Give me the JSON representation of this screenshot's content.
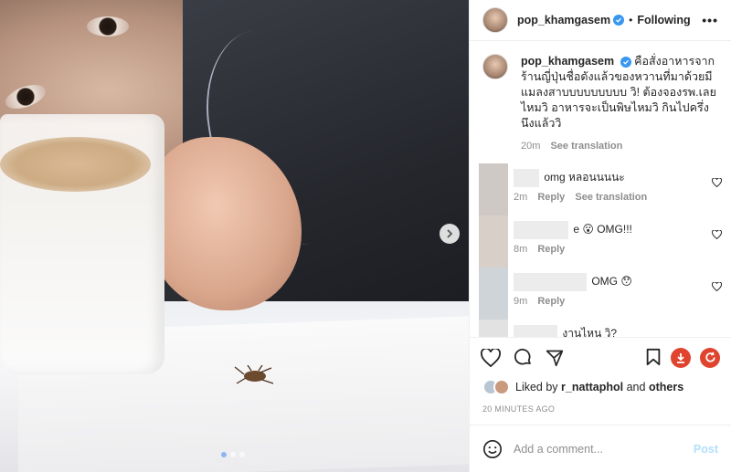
{
  "post": {
    "username": "pop_khamgasem",
    "follow_label": "Following",
    "dot_separator": "•",
    "more_label": "•••"
  },
  "caption": {
    "username": "pop_khamgasem",
    "text": "คือสั่งอาหารจากร้านญี่ปุ่นชื่อดังแล้วของหวานที่มาด้วยมีแมลงสาบบบบบบบบบ วิ! ต้องจองรพ.เลยไหมวิ อาหารจะเป็นพิษไหมวิ กินไปครึ่งนึงแล้ววิ",
    "age": "20m",
    "see_translation": "See translation"
  },
  "comments": [
    {
      "text": "omg หลอนนนนะ",
      "age": "2m",
      "reply": "Reply",
      "see_translation": "See translation"
    },
    {
      "text": "e 😮 OMG!!!",
      "age": "8m",
      "reply": "Reply"
    },
    {
      "text": "OMG 😯",
      "age": "9m",
      "reply": "Reply"
    },
    {
      "text": "งานไหน วิ?",
      "age": "",
      "reply": ""
    }
  ],
  "likes": {
    "prefix": "Liked by",
    "user": "r_nattaphol",
    "and": "and",
    "others": "others"
  },
  "timestamp": "20 MINUTES AGO",
  "add_comment": {
    "placeholder": "Add a comment...",
    "post_label": "Post"
  },
  "colors": {
    "verified": "#3897f0",
    "save_red": "#e0442e",
    "post_disabled": "#b2dffc"
  },
  "icons": [
    "heart-icon",
    "comment-icon",
    "share-icon",
    "bookmark-icon",
    "download-icon",
    "refresh-icon",
    "emoji-icon",
    "chevron-right-icon",
    "more-icon"
  ]
}
